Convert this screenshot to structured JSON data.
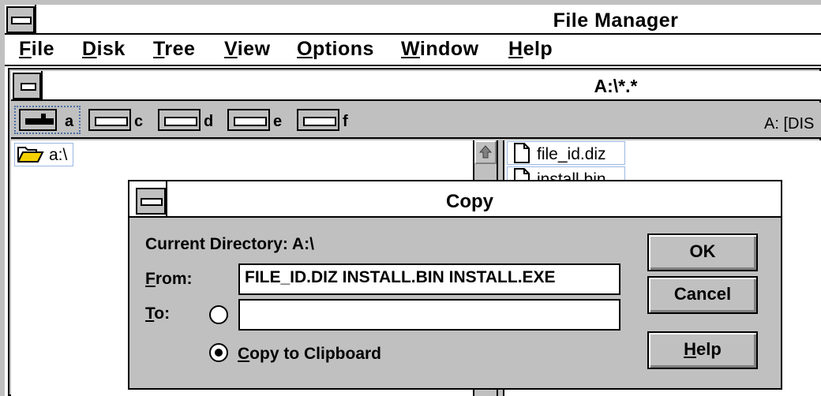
{
  "app": {
    "title": "File Manager"
  },
  "menu": [
    {
      "key": "F",
      "rest": "ile"
    },
    {
      "key": "D",
      "rest": "isk"
    },
    {
      "key": "T",
      "rest": "ree"
    },
    {
      "key": "V",
      "rest": "iew"
    },
    {
      "key": "O",
      "rest": "ptions"
    },
    {
      "key": "W",
      "rest": "indow"
    },
    {
      "key": "H",
      "rest": "elp"
    }
  ],
  "child": {
    "title": "A:\\*.*"
  },
  "drives": [
    {
      "letter": "a"
    },
    {
      "letter": "c"
    },
    {
      "letter": "d"
    },
    {
      "letter": "e"
    },
    {
      "letter": "f"
    }
  ],
  "drive_status": "A: [DIS",
  "tree": {
    "root_label": "a:\\"
  },
  "files": [
    {
      "name": "file_id.diz"
    },
    {
      "name": "install.bin"
    }
  ],
  "dialog": {
    "title": "Copy",
    "current_dir_label": "Current Directory: A:\\",
    "from_label_key": "F",
    "from_label_rest": "rom:",
    "from_value": "FILE_ID.DIZ INSTALL.BIN INSTALL.EXE",
    "to_label_key": "T",
    "to_label_rest": "o:",
    "to_value": "",
    "clipboard_key": "C",
    "clipboard_rest": "opy to Clipboard",
    "ok_label": "OK",
    "cancel_label": "Cancel",
    "help_key": "H",
    "help_rest": "elp"
  }
}
